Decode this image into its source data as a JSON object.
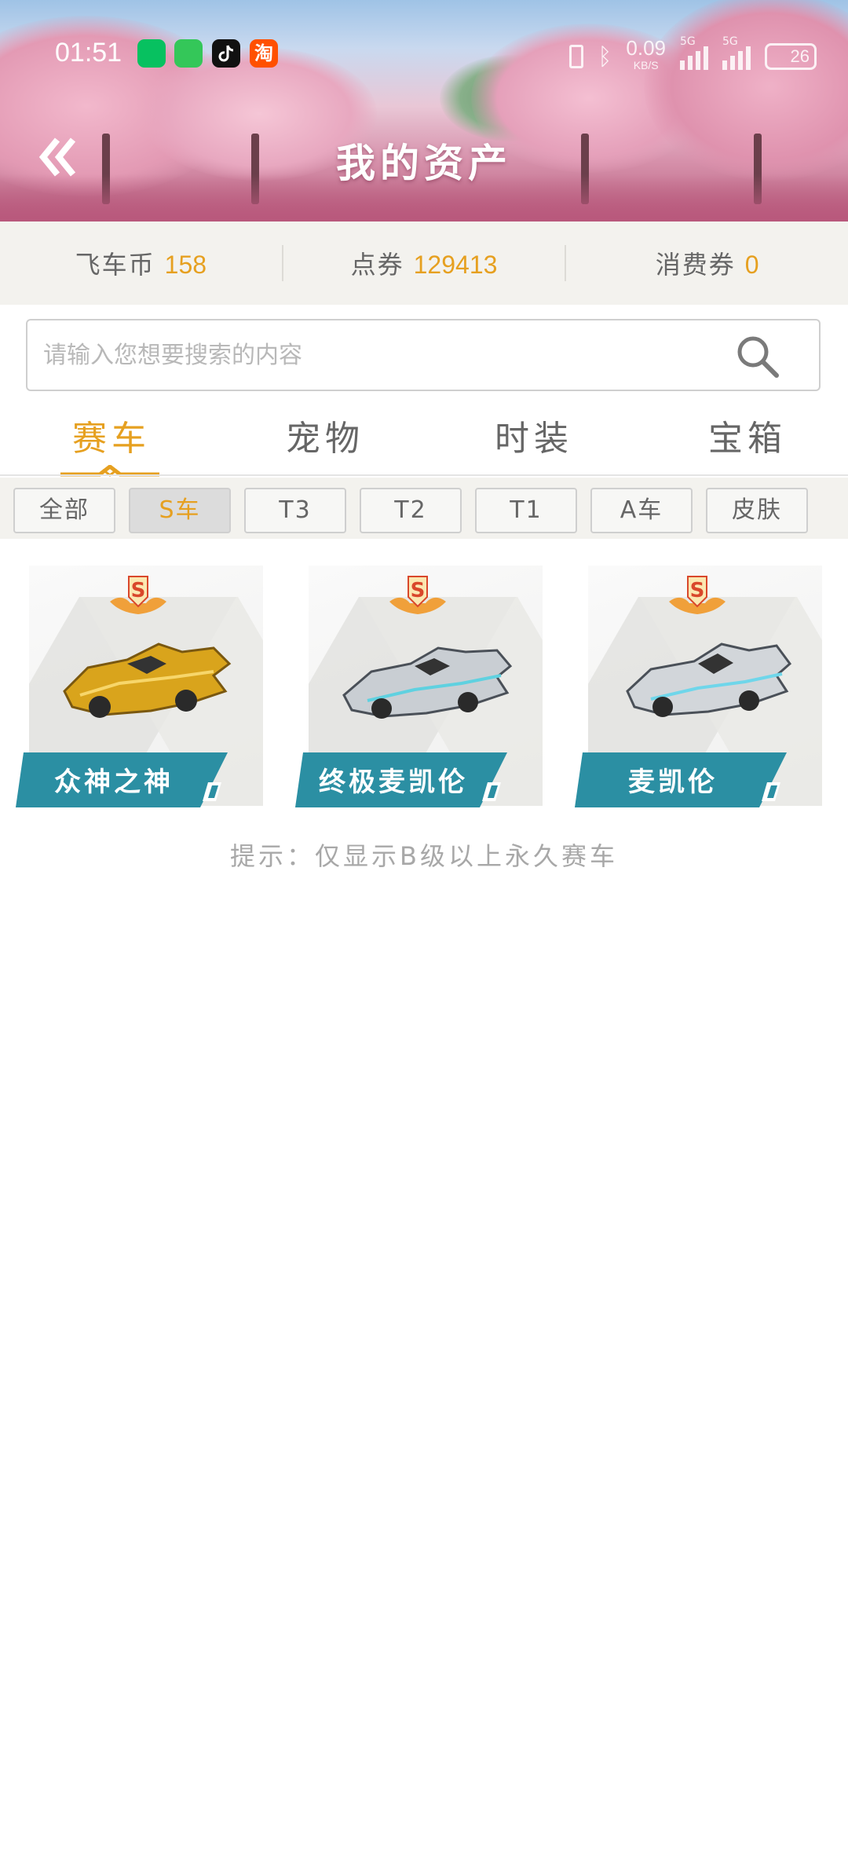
{
  "status_bar": {
    "time": "01:51",
    "apps": [
      "wechat-icon",
      "messages-icon",
      "tiktok-icon",
      "taobao-icon"
    ],
    "taobao_glyph": "淘",
    "speed_value": "0.09",
    "speed_unit": "KB/S",
    "network_1": "5G",
    "network_2": "5G",
    "battery": "26"
  },
  "header": {
    "title": "我的资产"
  },
  "balances": [
    {
      "label": "飞车币",
      "value": "158"
    },
    {
      "label": "点券",
      "value": "129413"
    },
    {
      "label": "消费券",
      "value": "0"
    }
  ],
  "search": {
    "placeholder": "请输入您想要搜索的内容"
  },
  "tabs": [
    {
      "label": "赛车",
      "active": true
    },
    {
      "label": "宠物",
      "active": false
    },
    {
      "label": "时装",
      "active": false
    },
    {
      "label": "宝箱",
      "active": false
    }
  ],
  "filters": [
    {
      "label": "全部",
      "active": false
    },
    {
      "label": "S车",
      "active": true
    },
    {
      "label": "T3",
      "active": false
    },
    {
      "label": "T2",
      "active": false
    },
    {
      "label": "T1",
      "active": false
    },
    {
      "label": "A车",
      "active": false
    },
    {
      "label": "皮肤",
      "active": false
    }
  ],
  "cars": [
    {
      "name": "众神之神",
      "grade": "S",
      "color": "#d9a41c"
    },
    {
      "name": "终极麦凯伦",
      "grade": "S",
      "color": "#c9ced3"
    },
    {
      "name": "麦凯伦",
      "grade": "S",
      "color": "#c9ced3"
    }
  ],
  "hint": "提示：仅显示B级以上永久赛车",
  "colors": {
    "accent": "#e6a020",
    "label_bar": "#2b8fa3",
    "badge_red": "#d9472b"
  }
}
